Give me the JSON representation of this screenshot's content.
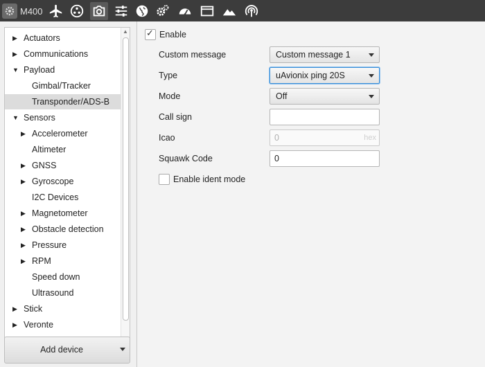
{
  "toolbar": {
    "device_name": "M400",
    "icons": [
      "settings-gear-icon",
      "airplane-icon",
      "mission-icon",
      "camera-icon",
      "sliders-icon",
      "globe-icon",
      "gears-icon",
      "speedometer-icon",
      "window-icon",
      "mountain-icon",
      "signal-icon"
    ],
    "active_icon": "camera-icon"
  },
  "tree": {
    "items": [
      {
        "label": "Actuators",
        "level": 0,
        "arrow": "right"
      },
      {
        "label": "Communications",
        "level": 0,
        "arrow": "right"
      },
      {
        "label": "Payload",
        "level": 0,
        "arrow": "down"
      },
      {
        "label": "Gimbal/Tracker",
        "level": 1,
        "arrow": ""
      },
      {
        "label": "Transponder/ADS-B",
        "level": 1,
        "arrow": "",
        "selected": true
      },
      {
        "label": "Sensors",
        "level": 0,
        "arrow": "down"
      },
      {
        "label": "Accelerometer",
        "level": 1,
        "arrow": "right"
      },
      {
        "label": "Altimeter",
        "level": 1,
        "arrow": ""
      },
      {
        "label": "GNSS",
        "level": 1,
        "arrow": "right"
      },
      {
        "label": "Gyroscope",
        "level": 1,
        "arrow": "right"
      },
      {
        "label": "I2C Devices",
        "level": 1,
        "arrow": ""
      },
      {
        "label": "Magnetometer",
        "level": 1,
        "arrow": "right"
      },
      {
        "label": "Obstacle detection",
        "level": 1,
        "arrow": "right"
      },
      {
        "label": "Pressure",
        "level": 1,
        "arrow": "right"
      },
      {
        "label": "RPM",
        "level": 1,
        "arrow": "right"
      },
      {
        "label": "Speed down",
        "level": 1,
        "arrow": ""
      },
      {
        "label": "Ultrasound",
        "level": 1,
        "arrow": ""
      },
      {
        "label": "Stick",
        "level": 0,
        "arrow": "right"
      },
      {
        "label": "Veronte",
        "level": 0,
        "arrow": "right"
      }
    ]
  },
  "add_device": {
    "label": "Add device"
  },
  "form": {
    "enable": {
      "label": "Enable",
      "checked": true
    },
    "custom_message": {
      "label": "Custom message",
      "value": "Custom message 1"
    },
    "type": {
      "label": "Type",
      "value": "uAvionix ping 20S"
    },
    "mode": {
      "label": "Mode",
      "value": "Off"
    },
    "call_sign": {
      "label": "Call sign",
      "value": ""
    },
    "icao": {
      "label": "Icao",
      "value": "0",
      "suffix": "hex"
    },
    "squawk": {
      "label": "Squawk Code",
      "value": "0"
    },
    "ident": {
      "label": "Enable ident mode",
      "checked": false
    }
  },
  "colors": {
    "toolbar_bg": "#3c3c3c",
    "focus_border": "#3b8fd8",
    "selected_row": "#dcdcdc"
  }
}
